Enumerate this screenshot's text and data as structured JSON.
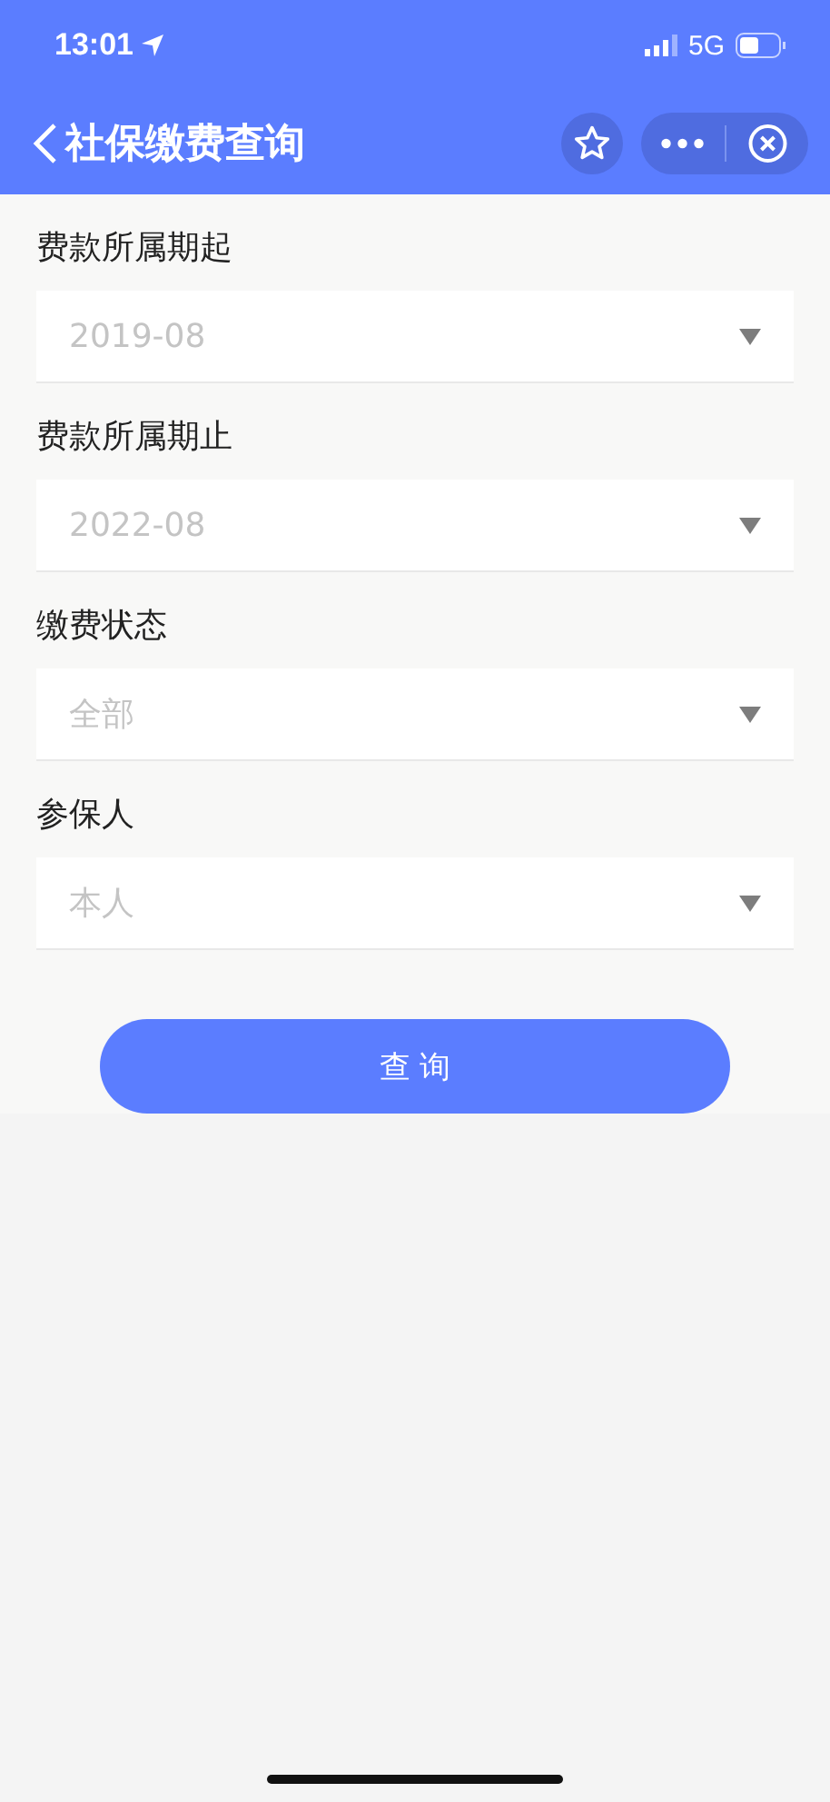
{
  "status_bar": {
    "time": "13:01",
    "network": "5G"
  },
  "nav": {
    "title": "社保缴费查询"
  },
  "fields": [
    {
      "label": "费款所属期起",
      "placeholder": "2019-08"
    },
    {
      "label": "费款所属期止",
      "placeholder": "2022-08"
    },
    {
      "label": "缴费状态",
      "placeholder": "全部"
    },
    {
      "label": "参保人",
      "placeholder": "本人"
    }
  ],
  "submit": {
    "label": "查 询"
  }
}
